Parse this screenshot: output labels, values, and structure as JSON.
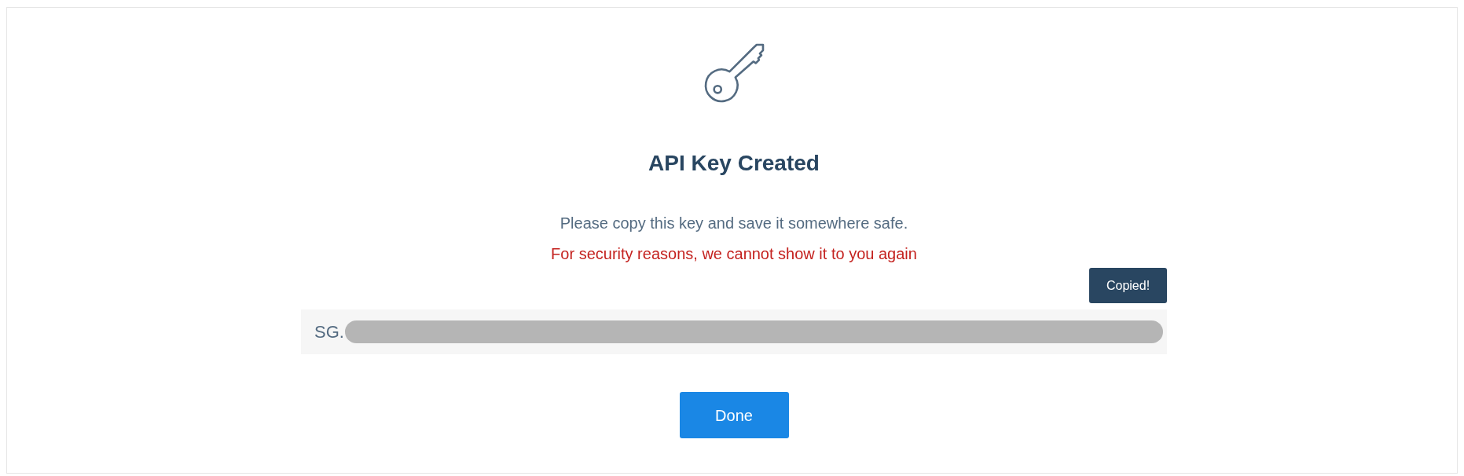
{
  "dialog": {
    "title": "API Key Created",
    "message": "Please copy this key and save it somewhere safe.",
    "warning": "For security reasons, we cannot show it to you again"
  },
  "copy_button": {
    "label": "Copied!"
  },
  "key_field": {
    "value": "SG.",
    "redacted": true
  },
  "done_button": {
    "label": "Done"
  }
}
